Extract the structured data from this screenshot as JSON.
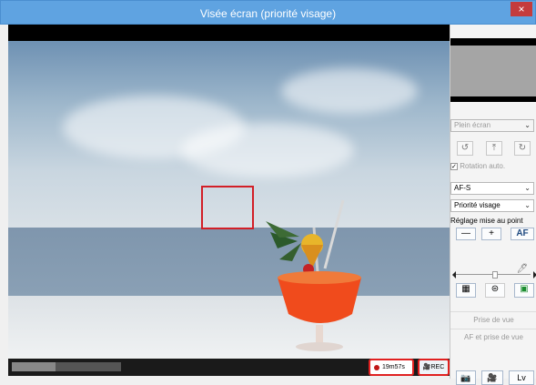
{
  "window": {
    "title": "Visée écran (priorité visage)",
    "close_icon": "×"
  },
  "status": {
    "record_time": "19m57s",
    "rec_label": "REC"
  },
  "panel": {
    "display_mode": "Plein écran",
    "rotation_auto": "Rotation auto.",
    "focus_mode": "AF-S",
    "af_area": "Priorité visage",
    "focus_adjust_label": "Réglage mise au point",
    "minus": "—",
    "plus": "+",
    "af_label": "AF",
    "prise_de_vue": "Prise de vue",
    "af_et_prise": "AF et prise de vue",
    "lv_label": "Lv"
  }
}
